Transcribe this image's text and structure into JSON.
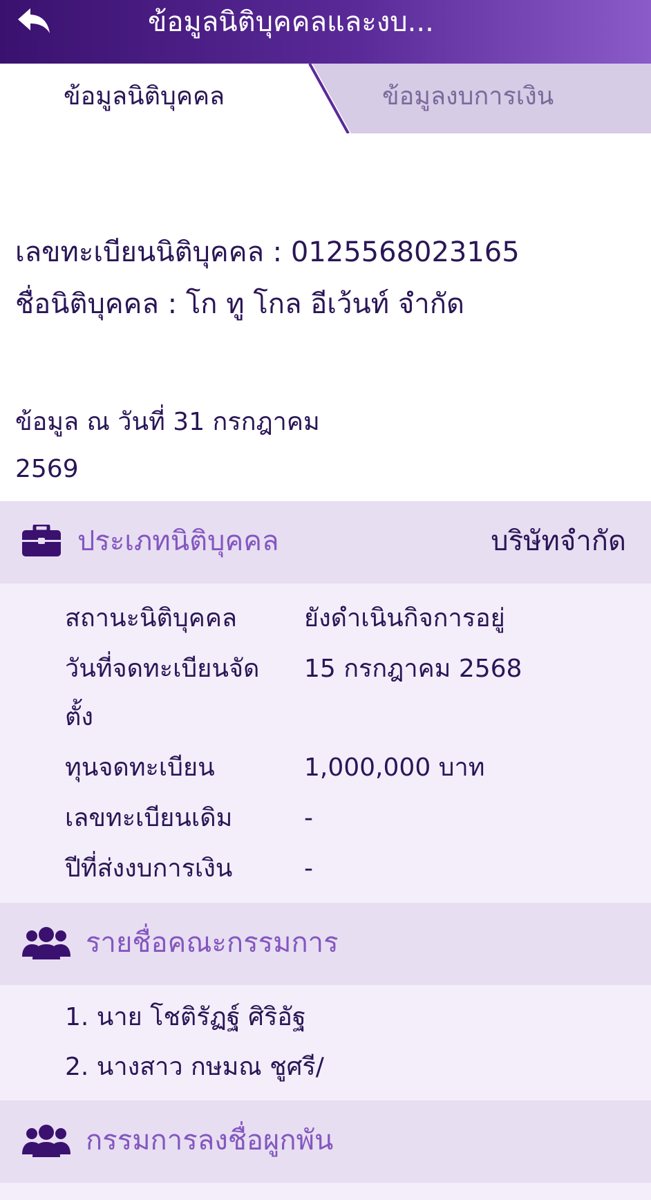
{
  "header": {
    "title": "ข้อมูลนิติบุคคลและงบ...",
    "back_icon": "reply-arrow-icon"
  },
  "tabs": [
    {
      "label": "ข้อมูลนิติบุคคล",
      "active": true
    },
    {
      "label": "ข้อมูลงบการเงิน",
      "active": false
    }
  ],
  "registration": {
    "number_line": "เลขทะเบียนนิติบุคคล : 0125568023165",
    "name_line": "ชื่อนิติบุคคล : โก ทู โกล อีเว้นท์ จำกัด"
  },
  "as_of": {
    "line1": "ข้อมูล ณ วันที่ 31 กรกฎาคม",
    "line2": "2569"
  },
  "entity_type": {
    "icon": "briefcase-icon",
    "label": "ประเภทนิติบุคคล",
    "value": "บริษัทจำกัด"
  },
  "details": [
    {
      "label": "สถานะนิติบุคคล",
      "value": "ยังดำเนินกิจการอยู่"
    },
    {
      "label": "วันที่จดทะเบียนจัดตั้ง",
      "value": "15 กรกฎาคม 2568"
    },
    {
      "label": "ทุนจดทะเบียน",
      "value": "1,000,000 บาท"
    },
    {
      "label": "เลขทะเบียนเดิม",
      "value": "-"
    },
    {
      "label": "ปีที่ส่งงบการเงิน",
      "value": "-"
    }
  ],
  "directors": {
    "icon": "users-icon",
    "title": "รายชื่อคณะกรรมการ",
    "list": [
      "1. นาย โชติรัฏฐ์  ศิริอัฐ",
      "2. นางสาว กษมณ  ชูศรี/"
    ]
  },
  "signatory": {
    "icon": "users-icon",
    "title": "กรรมการลงชื่อผูกพัน"
  },
  "colors": {
    "header_start": "#3a116f",
    "header_end": "#8a5bc9",
    "accent_text": "#8357bf",
    "dark_text": "#2a1656",
    "section_bg": "#e8def2",
    "body_bg": "#f4eefa",
    "inactive_tab_bg": "#d6cce6"
  }
}
